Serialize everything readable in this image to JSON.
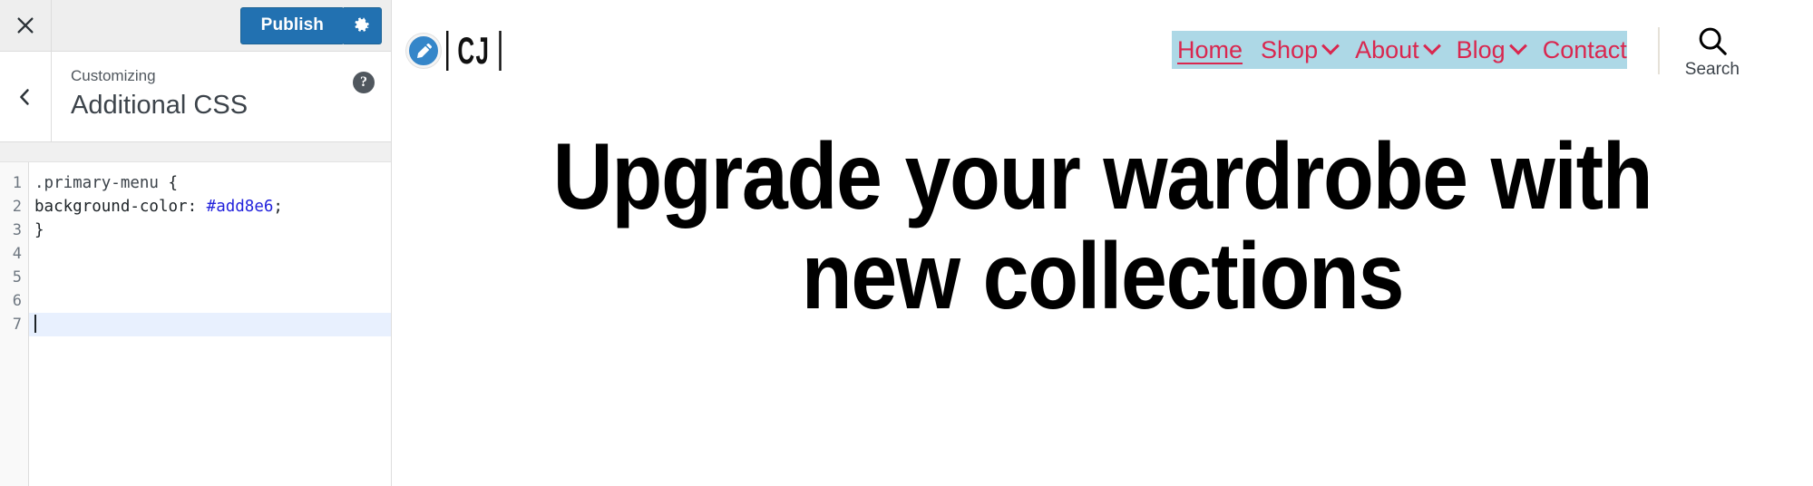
{
  "customizer": {
    "close_label": "Close",
    "publish_label": "Publish",
    "gear_icon": "gear-icon",
    "close_icon": "close-x-icon",
    "back_icon": "chevron-left-icon",
    "eyebrow": "Customizing",
    "title": "Additional CSS",
    "help_label": "?",
    "editor": {
      "language": "css",
      "active_line": 7,
      "line_numbers": [
        "1",
        "2",
        "3",
        "4",
        "5",
        "6",
        "7"
      ],
      "lines": [
        {
          "n": "1",
          "tokens": [
            {
              "t": ".primary-menu ",
              "c": "tok-sel"
            },
            {
              "t": "{",
              "c": "tok-punc"
            }
          ]
        },
        {
          "n": "2",
          "tokens": [
            {
              "t": "background-color: ",
              "c": "tok-prop"
            },
            {
              "t": "#add8e6",
              "c": "tok-val"
            },
            {
              "t": ";",
              "c": "tok-punc"
            }
          ]
        },
        {
          "n": "3",
          "tokens": [
            {
              "t": "}",
              "c": "tok-punc"
            }
          ]
        },
        {
          "n": "4",
          "tokens": []
        },
        {
          "n": "5",
          "tokens": []
        },
        {
          "n": "6",
          "tokens": []
        },
        {
          "n": "7",
          "tokens": []
        }
      ],
      "raw_css": ".primary-menu {\nbackground-color: #add8e6;\n}"
    }
  },
  "preview": {
    "edit_pencil_icon": "pencil-edit-icon",
    "brand": "CJ",
    "nav": {
      "background_color": "#add8e6",
      "link_color": "#d9274f",
      "items": [
        {
          "label": "Home",
          "has_dropdown": false,
          "current": true
        },
        {
          "label": "Shop",
          "has_dropdown": true,
          "current": false
        },
        {
          "label": "About",
          "has_dropdown": true,
          "current": false
        },
        {
          "label": "Blog",
          "has_dropdown": true,
          "current": false
        },
        {
          "label": "Contact",
          "has_dropdown": false,
          "current": false
        }
      ]
    },
    "search": {
      "icon": "search-magnifier-icon",
      "label": "Search"
    },
    "hero": {
      "headline": "Upgrade your wardrobe with new collections"
    }
  },
  "colors": {
    "publish_blue": "#2271b1",
    "nav_blue": "#add8e6",
    "nav_link_red": "#d9274f",
    "active_line": "#e8f0fe",
    "css_value_blue": "#2323dc"
  }
}
